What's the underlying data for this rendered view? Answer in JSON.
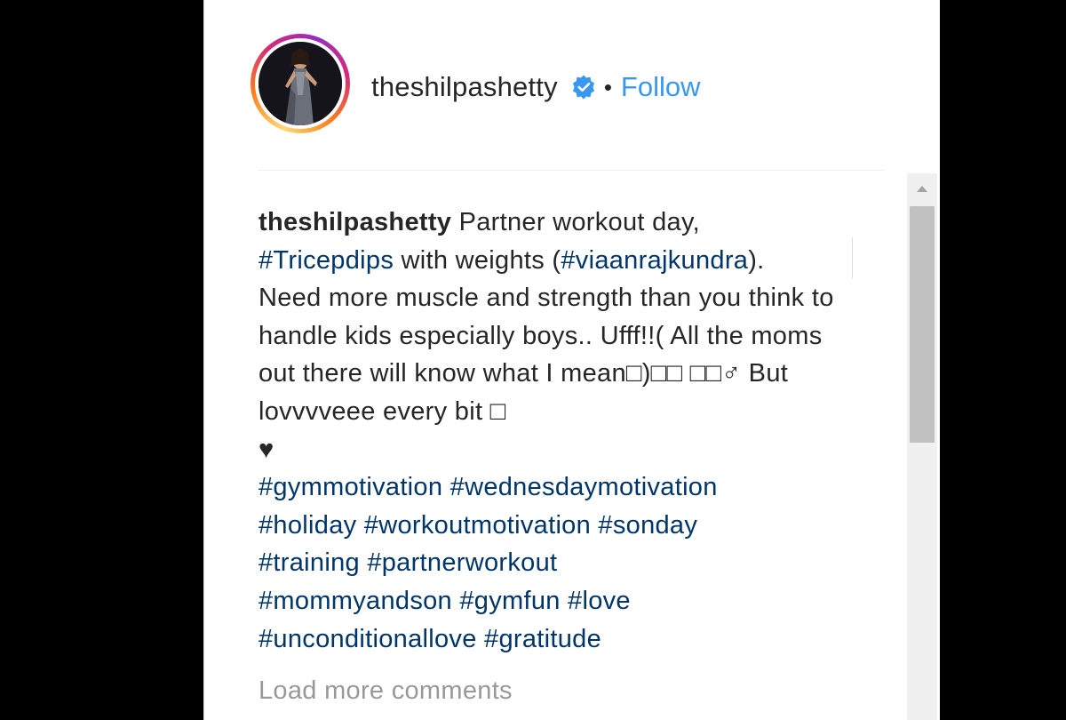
{
  "post": {
    "username": "theshilpashetty",
    "separator": "•",
    "follow_label": "Follow",
    "verified_icon": "verified-badge-icon",
    "accent_color": "#3897f0",
    "hashtag_color": "#003569"
  },
  "caption": {
    "author": "theshilpashetty",
    "line1_text": " Partner workout day,",
    "tag_tricepdips": "#Tricepdips",
    "line2_mid": " with weights (",
    "tag_viaan": "#viaanrajkundra",
    "line2_end": ").",
    "body_text": "Need more muscle and strength than you think to handle kids especially boys.. Ufff!!( All the moms out there will know what I mean□)□□ □□♂ But lovvvveee every bit □",
    "heart": "♥",
    "hashtags": [
      "#gymmotivation",
      "#wednesdaymotivation",
      "#holiday",
      "#workoutmotivation",
      "#sonday",
      "#training",
      "#partnerworkout",
      "#mommyandson",
      "#gymfun",
      "#love",
      "#unconditionallove",
      "#gratitude"
    ]
  },
  "comments": {
    "load_more_label": "Load more comments"
  }
}
